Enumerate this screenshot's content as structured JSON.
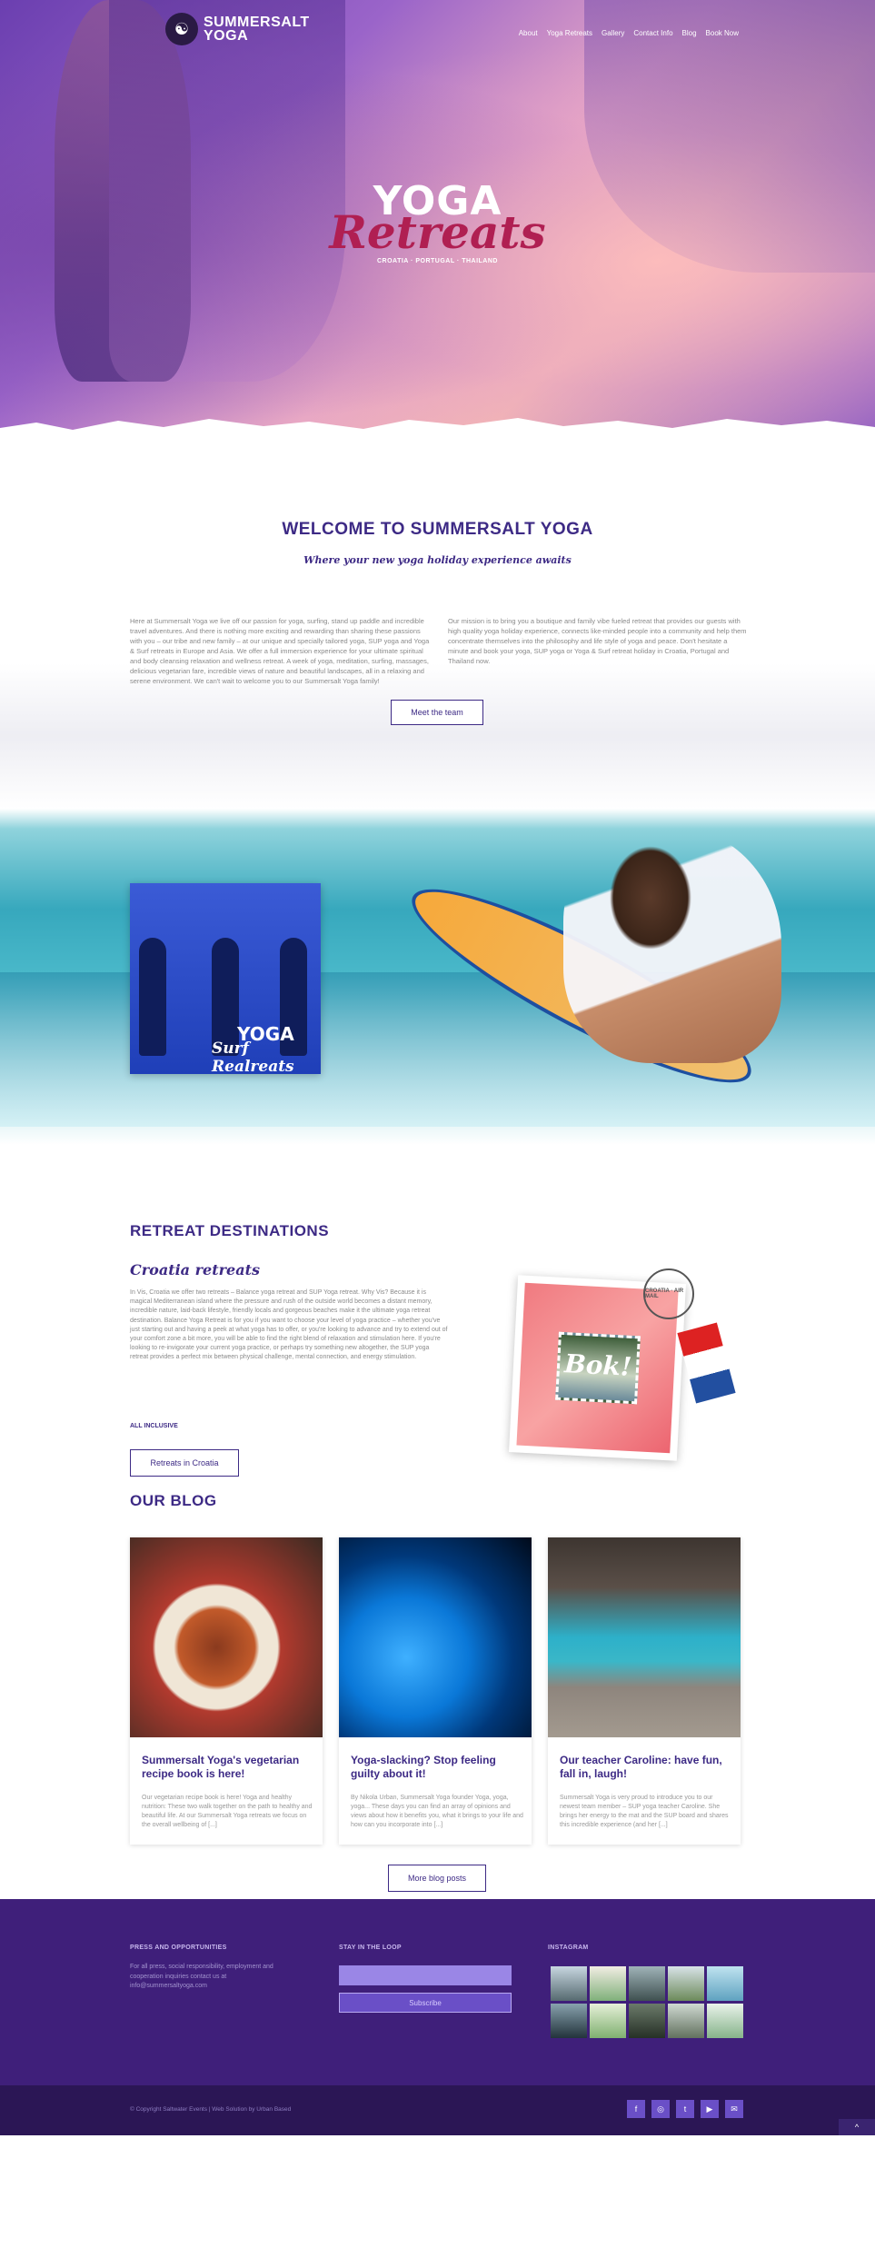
{
  "brand": {
    "name_line1": "SUMMERSALT",
    "name_line2": "YOGA"
  },
  "nav": {
    "items": [
      "About",
      "Yoga Retreats",
      "Gallery",
      "Contact Info",
      "Blog",
      "Book Now"
    ]
  },
  "hero": {
    "title": "YOGA",
    "script": "Retreats",
    "subtitle": "CROATIA · PORTUGAL · THAILAND"
  },
  "welcome": {
    "title": "WELCOME TO SUMMERSALT YOGA",
    "tagline": "Where your new yoga holiday experience awaits",
    "left_text": "Here at Summersalt Yoga we live off our passion for yoga, surfing, stand up paddle and incredible travel adventures. And there is nothing more exciting and rewarding than sharing these passions with you – our tribe and new family – at our unique and specially tailored yoga, SUP yoga and Yoga & Surf retreats in Europe and Asia. We offer a full immersion experience for your ultimate spiritual and body cleansing relaxation and wellness retreat. A week of yoga, meditation, surfing, massages, delicious vegetarian fare, incredible views of nature and beautiful landscapes, all in a relaxing and serene environment. We can't wait to welcome you to our Summersalt Yoga family!",
    "right_text": "Our mission is to bring you a boutique and family vibe fueled retreat that provides our guests with high quality yoga holiday experience, connects like-minded people into a community and help them concentrate themselves into the philosophy and life style of yoga and peace. Don't hesitate a minute and book your yoga, SUP yoga or Yoga & Surf retreat holiday in Croatia, Portugal and Thailand now.",
    "button": "Meet the team"
  },
  "surf": {
    "label1": "YOGA",
    "label2": "Surf Realreats"
  },
  "destinations": {
    "title": "RETREAT DESTINATIONS",
    "subtitle": "Croatia retreats",
    "text": "In Vis, Croatia we offer two retreats – Balance yoga retreat and SUP Yoga retreat. Why Vis? Because it is magical Mediterranean island where the pressure and rush of the outside world becomes a distant memory, incredible nature, laid-back lifestyle, friendly locals and gorgeous beaches make it the ultimate yoga retreat destination. Balance Yoga Retreat is for you if you want to choose your level of yoga practice – whether you've just starting out and having a peek at what yoga has to offer, or you're looking to advance and try to extend out of your comfort zone a bit more, you will be able to find the right blend of relaxation and stimulation here. If you're looking to re-invigorate your current yoga practice, or perhaps try something new altogether, the SUP yoga retreat provides a perfect mix between physical challenge, mental connection, and energy stimulation.",
    "included": "ALL INCLUSIVE",
    "button": "Retreats in Croatia",
    "postcard_word": "Bok!",
    "stamp": "CROATIA · AIR MAIL"
  },
  "blog": {
    "title": "OUR BLOG",
    "posts": [
      {
        "title": "Summersalt Yoga's vegetarian recipe book is here!",
        "excerpt": "Our vegetarian recipe book is here! Yoga and healthy nutrition: These two walk together on the path to healthy and beautiful life. At our Summersalt Yoga retreats we focus on the overall wellbeing of [...]"
      },
      {
        "title": "Yoga-slacking? Stop feeling guilty about it!",
        "excerpt": "By Nikola Urban, Summersalt Yoga founder Yoga, yoga, yoga... These days you can find an array of opinions and views about how it benefits you, what it brings to your life and how can you incorporate into [...]"
      },
      {
        "title": "Our teacher Caroline: have fun, fall in, laugh!",
        "excerpt": "Summersalt Yoga is very proud to introduce you to our newest team member – SUP yoga teacher Caroline. She brings her energy to the mat and the SUP board and shares this incredible experience (and her [...]"
      }
    ],
    "button": "More blog posts"
  },
  "footer": {
    "press_title": "PRESS AND OPPORTUNITIES",
    "press_text": "For all press, social responsibility, employment and cooperation inquiries contact us at info@summersaltyoga.com",
    "loop_title": "STAY IN THE LOOP",
    "subscribe": "Subscribe",
    "instagram_title": "INSTAGRAM",
    "copyright": "© Copyright Saltwater Events  |  Web Solution by Urban Based"
  }
}
